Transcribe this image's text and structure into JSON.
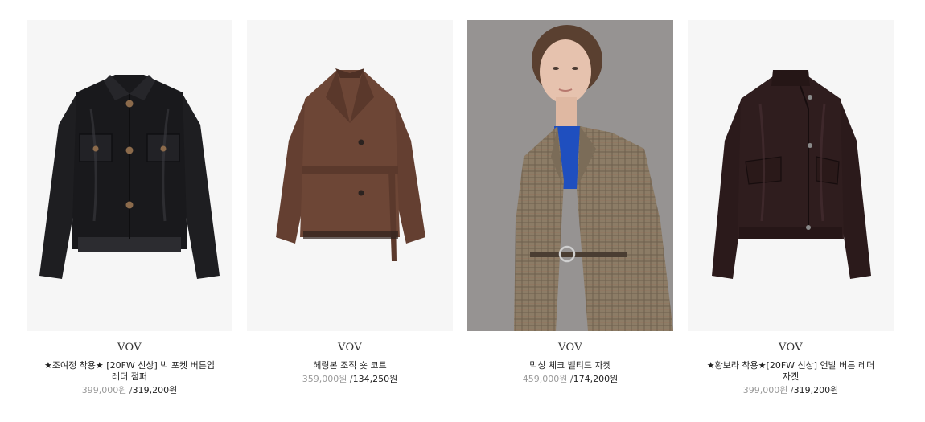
{
  "products": [
    {
      "brand": "VOV",
      "name": "★조여정 착용★ [20FW 신상] 빅 포켓 버튼업 레더 점퍼",
      "original_price": "399,000원",
      "separator": " /",
      "sale_price": "319,200원",
      "image_icon": "black-leather-jumper-image"
    },
    {
      "brand": "VOV",
      "name": "헤링본 조직 숏 코트",
      "original_price": "359,000원",
      "separator": " /",
      "sale_price": "134,250원",
      "image_icon": "brown-herringbone-coat-image"
    },
    {
      "brand": "VOV",
      "name": "믹싱 체크 벨티드 자켓",
      "original_price": "459,000원",
      "separator": " /",
      "sale_price": "174,200원",
      "image_icon": "belted-check-jacket-model-image"
    },
    {
      "brand": "VOV",
      "name": "★황보라 착용★[20FW 신상] 언발 버튼 레더 자켓",
      "original_price": "399,000원",
      "separator": " /",
      "sale_price": "319,200원",
      "image_icon": "dark-brown-leather-jacket-image"
    }
  ],
  "colors": {
    "tile_background": "#f6f6f6",
    "black_leather": "#1b1b1e",
    "brown_herringbone": "#6b4536",
    "check_jacket": "#8a7a64",
    "dark_brown_leather": "#2c1b1c",
    "original_price": "#9a9a9a",
    "sale_price": "#222222"
  }
}
